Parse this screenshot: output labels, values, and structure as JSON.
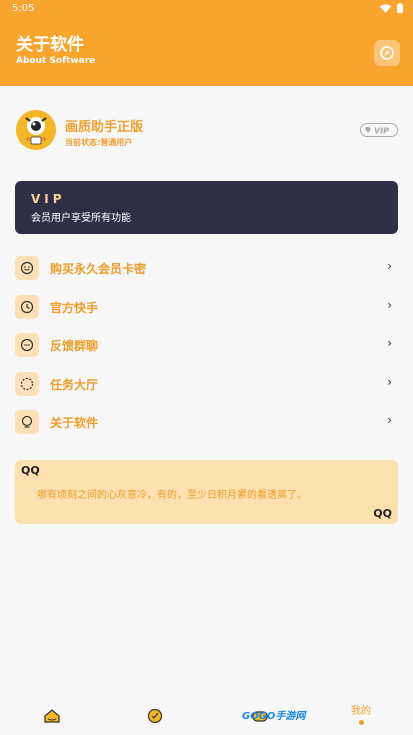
{
  "status_bar": {
    "time": "5:05"
  },
  "header": {
    "title": "关于软件",
    "subtitle": "About Software"
  },
  "profile": {
    "name": "画质助手正版",
    "status": "当前状态:普通用户",
    "badge": "VIP"
  },
  "vip_card": {
    "title": "VIP",
    "description": "会员用户享受所有功能"
  },
  "menu": {
    "items": [
      {
        "label": "购买永久会员卡密",
        "icon": "card-icon"
      },
      {
        "label": "官方快手",
        "icon": "clock-icon"
      },
      {
        "label": "反馈群聊",
        "icon": "chat-icon"
      },
      {
        "label": "任务大厅",
        "icon": "task-icon"
      },
      {
        "label": "关于软件",
        "icon": "info-icon"
      }
    ],
    "arrow": "›"
  },
  "quote": {
    "open_mark": "QQ",
    "close_mark": "QQ",
    "text": "哪有顷刻之间的心灰意冷，有的，至少日积月累的看透离了。"
  },
  "bottom_nav": {
    "items": [
      {
        "icon": "home-icon"
      },
      {
        "icon": "explore-icon"
      },
      {
        "icon": "game-icon"
      },
      {
        "label": "我的",
        "icon": "mine-dot"
      }
    ],
    "watermark": "GOGO手游网"
  },
  "colors": {
    "primary": "#f9a52d",
    "accent_text": "#ee9e2a",
    "vip_bg": "#2f3047"
  }
}
